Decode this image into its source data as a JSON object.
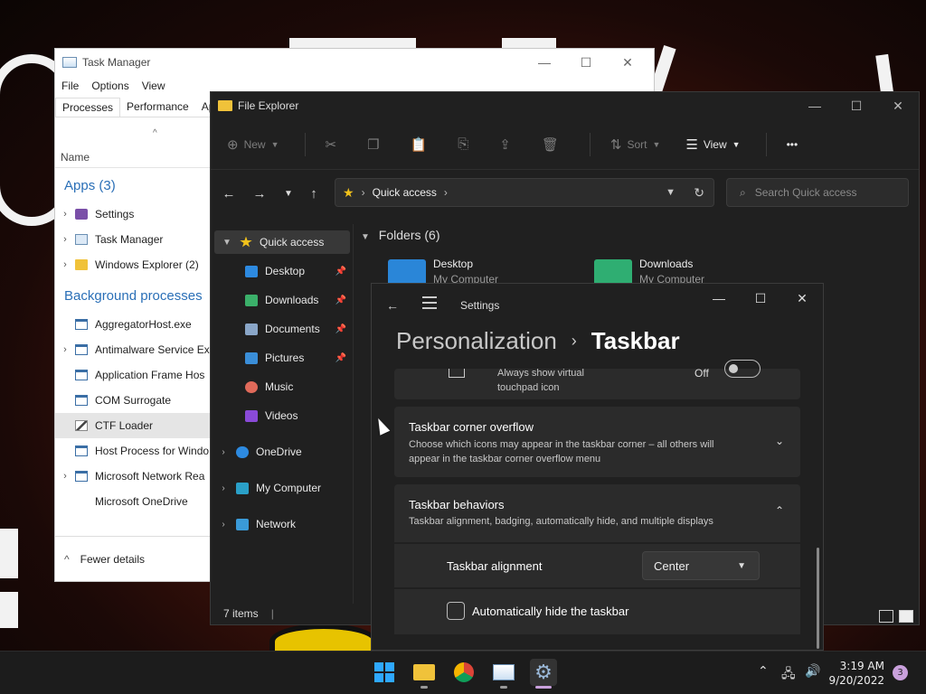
{
  "task_manager": {
    "title": "Task Manager",
    "menu": [
      "File",
      "Options",
      "View"
    ],
    "tabs": [
      "Processes",
      "Performance",
      "App"
    ],
    "column_name": "Name",
    "apps_header": "Apps (3)",
    "apps": [
      "Settings",
      "Task Manager",
      "Windows Explorer (2)"
    ],
    "bg_header": "Background processes",
    "bg": [
      "AggregatorHost.exe",
      "Antimalware Service Ex",
      "Application Frame Hos",
      "COM Surrogate",
      "CTF Loader",
      "Host Process for Windo",
      "Microsoft Network Rea",
      "Microsoft OneDrive"
    ],
    "fewer_details": "Fewer details"
  },
  "file_explorer": {
    "title": "File Explorer",
    "toolbar": {
      "new": "New",
      "sort": "Sort",
      "view": "View",
      "more": "•••"
    },
    "address": "Quick access",
    "search_placeholder": "Search Quick access",
    "sidebar": {
      "quick_access": "Quick access",
      "items": [
        "Desktop",
        "Downloads",
        "Documents",
        "Pictures",
        "Music",
        "Videos"
      ],
      "onedrive": "OneDrive",
      "my_computer": "My Computer",
      "network": "Network"
    },
    "folders_header": "Folders (6)",
    "folders": [
      {
        "name": "Desktop",
        "sub": "My Computer"
      },
      {
        "name": "Downloads",
        "sub": "My Computer"
      }
    ],
    "status": "7 items",
    "status_sep": "|"
  },
  "settings": {
    "app_title": "Settings",
    "breadcrumb_parent": "Personalization",
    "breadcrumb_current": "Taskbar",
    "touchpad": {
      "title": "Always show virtual",
      "subtitle": "touchpad icon",
      "state": "Off"
    },
    "corner_overflow": {
      "title": "Taskbar corner overflow",
      "desc_line1": "Choose which icons may appear in the taskbar corner – all others will",
      "desc_line2": "appear in the taskbar corner overflow menu"
    },
    "behaviors": {
      "title": "Taskbar behaviors",
      "desc": "Taskbar alignment, badging, automatically hide, and multiple displays"
    },
    "alignment_label": "Taskbar alignment",
    "alignment_value": "Center",
    "autohide_label": "Automatically hide the taskbar"
  },
  "taskbar": {
    "time": "3:19 AM",
    "date": "9/20/2022",
    "notification_count": "3"
  },
  "colors": {
    "accent": "#2ea8ff",
    "folder": "#f0c23a",
    "tm_link": "#2a6fb7"
  }
}
